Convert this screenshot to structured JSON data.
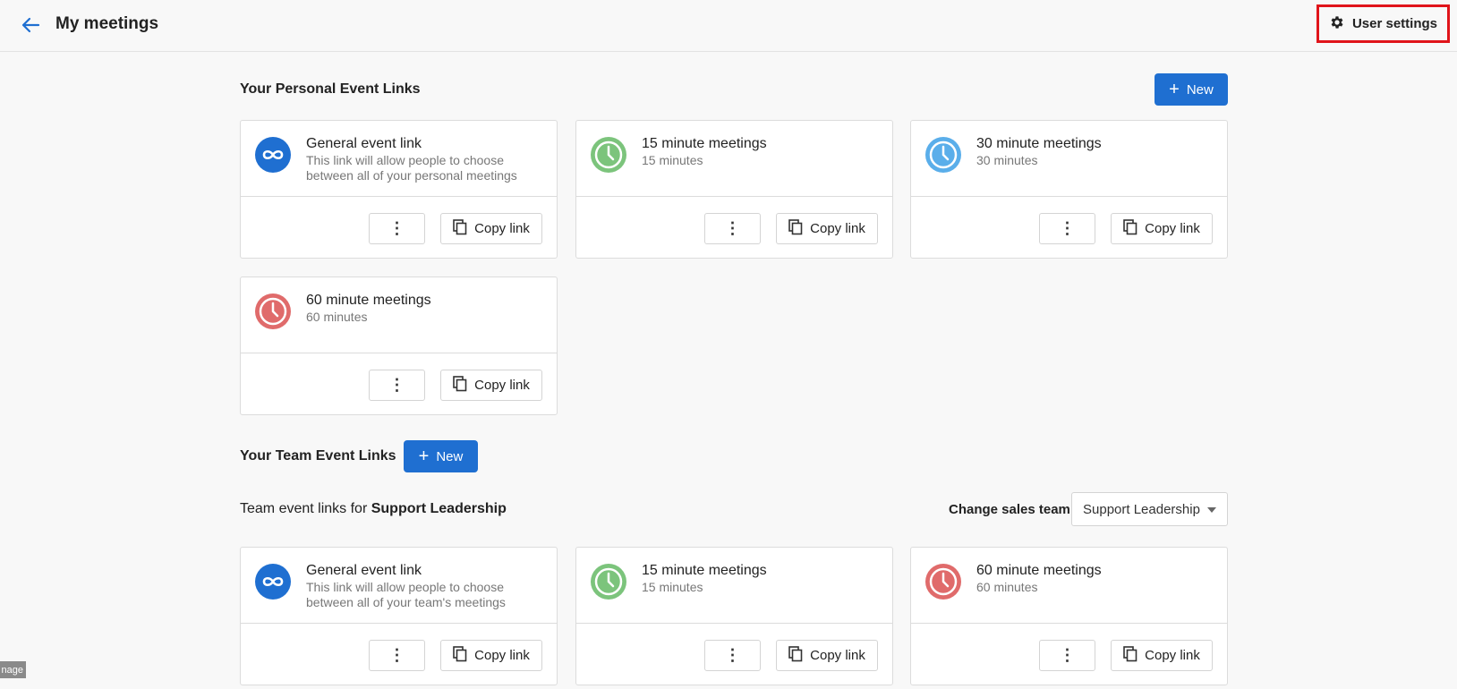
{
  "header": {
    "title": "My meetings",
    "user_settings_label": "User settings"
  },
  "personal": {
    "title": "Your Personal Event Links",
    "new_label": "New",
    "cards": [
      {
        "title": "General event link",
        "subtitle": "This link will allow people to choose between all of your personal meetings",
        "icon": "infinity-icon",
        "color": "#1f6fd1",
        "copy_label": "Copy link"
      },
      {
        "title": "15 minute meetings",
        "subtitle": "15 minutes",
        "icon": "clock-icon",
        "color": "#7cc47c",
        "copy_label": "Copy link"
      },
      {
        "title": "30 minute meetings",
        "subtitle": "30 minutes",
        "icon": "clock-icon",
        "color": "#5aaeea",
        "copy_label": "Copy link"
      },
      {
        "title": "60 minute meetings",
        "subtitle": "60 minutes",
        "icon": "clock-icon",
        "color": "#e06b6b",
        "copy_label": "Copy link"
      }
    ]
  },
  "team": {
    "title": "Your Team Event Links",
    "new_label": "New",
    "links_for_prefix": "Team event links for",
    "team_name": "Support Leadership",
    "change_label": "Change sales team",
    "selected_team": "Support Leadership",
    "cards": [
      {
        "title": "General event link",
        "subtitle": "This link will allow people to choose between all of your team's meetings",
        "icon": "infinity-icon",
        "color": "#1f6fd1",
        "copy_label": "Copy link"
      },
      {
        "title": "15 minute meetings",
        "subtitle": "15 minutes",
        "icon": "clock-icon",
        "color": "#7cc47c",
        "copy_label": "Copy link"
      },
      {
        "title": "60 minute meetings",
        "subtitle": "60 minutes",
        "icon": "clock-icon",
        "color": "#e06b6b",
        "copy_label": "Copy link"
      }
    ]
  },
  "corner_tag": "nage"
}
